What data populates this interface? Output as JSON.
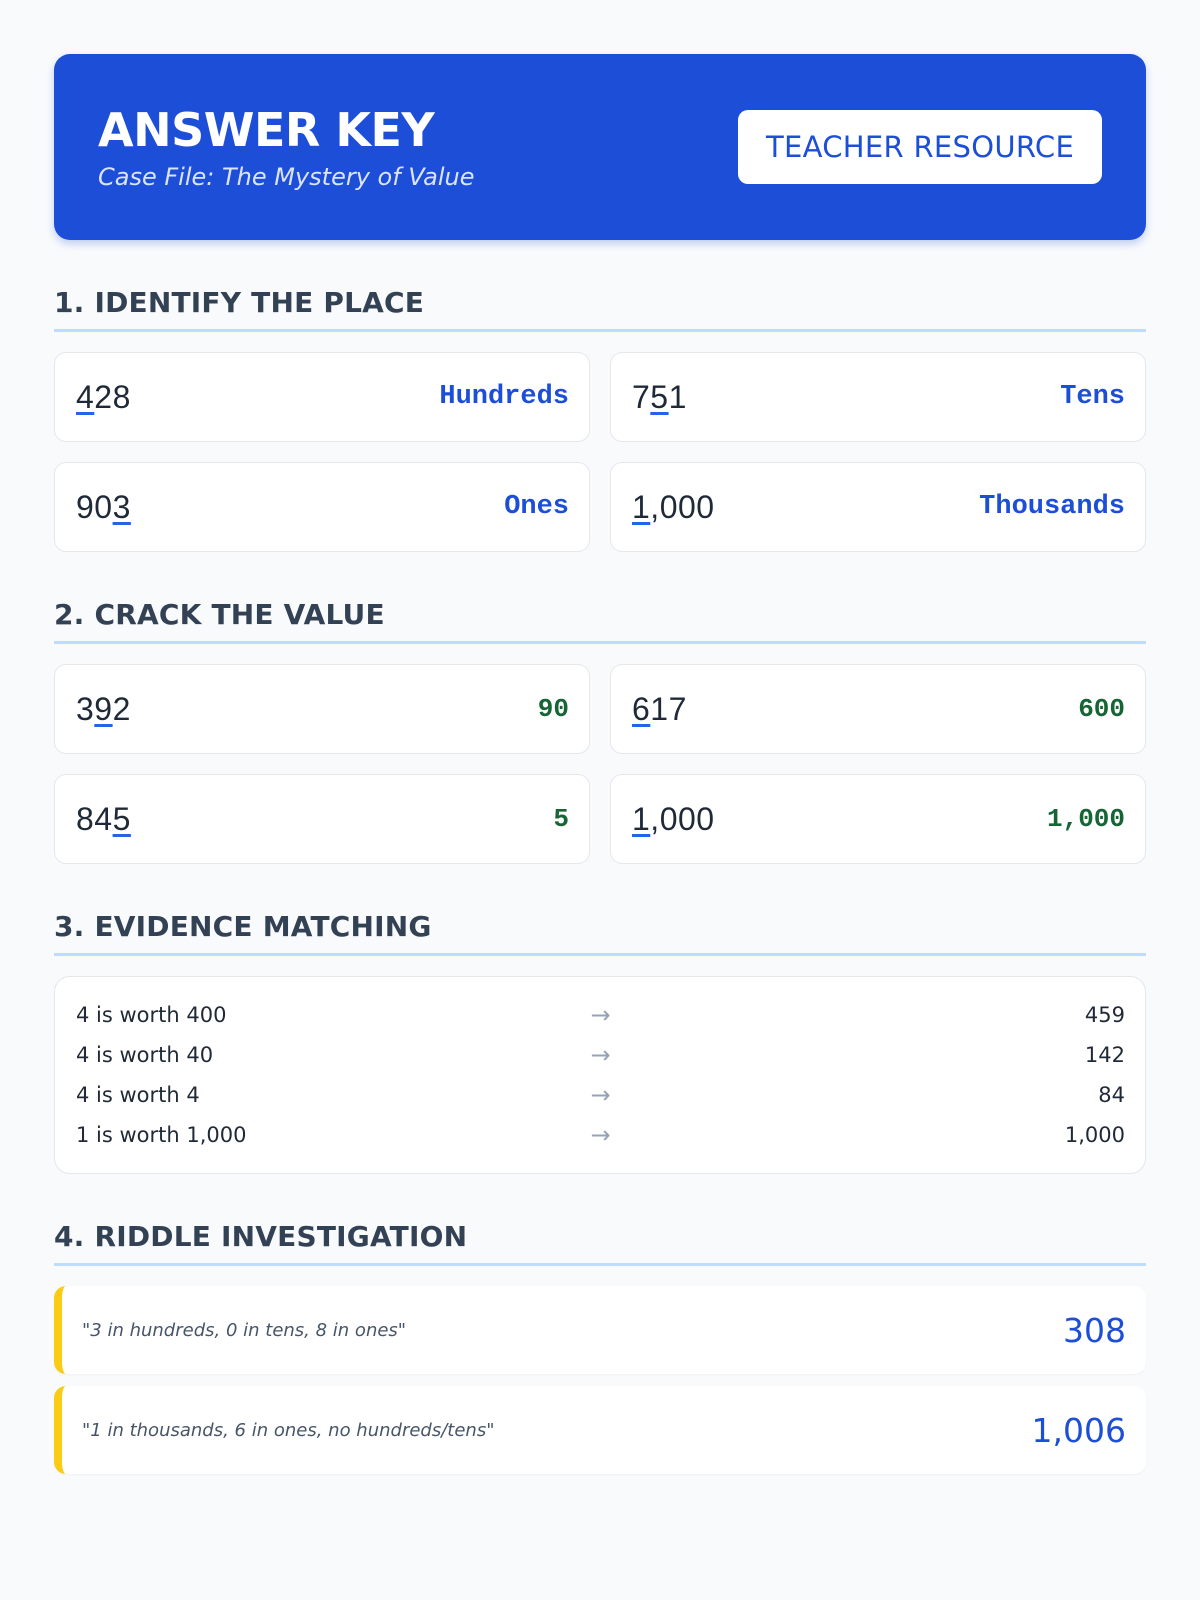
{
  "header": {
    "title": "ANSWER KEY",
    "subtitle": "Case File: The Mystery of Value",
    "badge": "TEACHER RESOURCE"
  },
  "colors": {
    "header_bg": "#1d4ed8",
    "answer_blue": "#1d4ed8",
    "answer_green": "#166534",
    "riddle_accent": "#facc15",
    "section_rule": "#bfdbfe"
  },
  "sections": {
    "place": {
      "title": "1. IDENTIFY THE PLACE",
      "items": [
        {
          "pre": "",
          "digit": "4",
          "post": "28",
          "answer": "Hundreds"
        },
        {
          "pre": "7",
          "digit": "5",
          "post": "1",
          "answer": "Tens"
        },
        {
          "pre": "90",
          "digit": "3",
          "post": "",
          "answer": "Ones"
        },
        {
          "pre": "",
          "digit": "1",
          "post": ",000",
          "answer": "Thousands"
        }
      ]
    },
    "value": {
      "title": "2. CRACK THE VALUE",
      "items": [
        {
          "pre": "3",
          "digit": "9",
          "post": "2",
          "answer": "90"
        },
        {
          "pre": "",
          "digit": "6",
          "post": "17",
          "answer": "600"
        },
        {
          "pre": "84",
          "digit": "5",
          "post": "",
          "answer": "5"
        },
        {
          "pre": "",
          "digit": "1",
          "post": ",000",
          "answer": "1,000"
        }
      ]
    },
    "matching": {
      "title": "3. EVIDENCE MATCHING",
      "arrow_icon": "arrow-right-icon",
      "rows": [
        {
          "clue": "4 is worth 400",
          "number": "459"
        },
        {
          "clue": "4 is worth 40",
          "number": "142"
        },
        {
          "clue": "4 is worth 4",
          "number": "84"
        },
        {
          "clue": "1 is worth 1,000",
          "number": "1,000"
        }
      ]
    },
    "riddle": {
      "title": "4. RIDDLE INVESTIGATION",
      "items": [
        {
          "text": "\"3 in hundreds, 0 in tens, 8 in ones\"",
          "answer": "308"
        },
        {
          "text": "\"1 in thousands, 6 in ones, no hundreds/tens\"",
          "answer": "1,006"
        }
      ]
    }
  }
}
